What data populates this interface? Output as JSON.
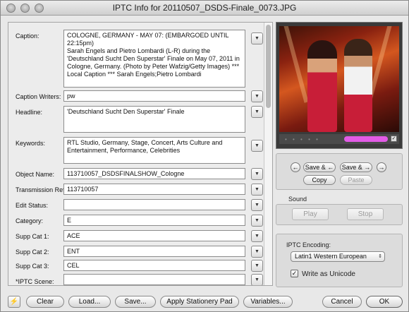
{
  "window": {
    "title": "IPTC Info for 20110507_DSDS-Finale_0073.JPG"
  },
  "fields": {
    "caption": {
      "label": "Caption:",
      "value": "COLOGNE, GERMANY - MAY 07: (EMBARGOED UNTIL 22:15pm)\nSarah Engels and Pietro Lombardi (L-R) during the 'Deutschland Sucht Den Superstar' Finale on May 07, 2011 in Cologne, Germany. (Photo by Peter Wafzig/Getty Images) *** Local Caption *** Sarah Engels;Pietro Lombardi"
    },
    "caption_writers": {
      "label": "Caption Writers:",
      "value": "pw"
    },
    "headline": {
      "label": "Headline:",
      "value": "'Deutschland Sucht Den Superstar' Finale"
    },
    "keywords": {
      "label": "Keywords:",
      "value": "RTL Studio, Germany, Stage, Concert, Arts Culture and Entertainment, Performance, Celebrities"
    },
    "object_name": {
      "label": "Object Name:",
      "value": "113710057_DSDSFINALSHOW_Cologne"
    },
    "transmission_ref": {
      "label": "Transmission Ref:",
      "value": "113710057"
    },
    "edit_status": {
      "label": "Edit Status:",
      "value": ""
    },
    "category": {
      "label": "Category:",
      "value": "E"
    },
    "supp_cat_1": {
      "label": "Supp Cat 1:",
      "value": "ACE"
    },
    "supp_cat_2": {
      "label": "Supp Cat 2:",
      "value": "ENT"
    },
    "supp_cat_3": {
      "label": "Supp Cat 3:",
      "value": "CEL"
    },
    "iptc_scene": {
      "label": "*IPTC Scene:",
      "value": ""
    }
  },
  "dropdown_glyph": "▼",
  "preview": {
    "dots": "• • • • •"
  },
  "clipboard": {
    "prev_arrow": "←",
    "next_arrow": "→",
    "save_prev_label": "Save & ←",
    "save_next_label": "Save & →",
    "copy_label": "Copy",
    "paste_label": "Paste"
  },
  "sound": {
    "title": "Sound",
    "play_label": "Play",
    "stop_label": "Stop"
  },
  "encoding": {
    "title": "IPTC Encoding:",
    "selected": "Latin1 Western European",
    "write_unicode_label": "Write as Unicode",
    "write_unicode_checked": true
  },
  "toolbar": {
    "bolt_glyph": "⚡",
    "clear_label": "Clear",
    "load_label": "Load...",
    "save_label": "Save...",
    "apply_label": "Apply Stationery Pad",
    "variables_label": "Variables...",
    "cancel_label": "Cancel",
    "ok_label": "OK"
  }
}
